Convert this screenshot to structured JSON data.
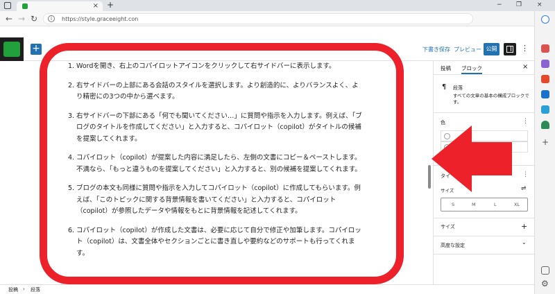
{
  "browser": {
    "url": "https://style.graceeight.con",
    "tab_close": "×",
    "new_tab": "+",
    "window_controls": [
      "−",
      "❐",
      "×"
    ]
  },
  "editor_toolbar": {
    "save_draft": "下書き保存",
    "preview": "プレビュー",
    "publish": "公開",
    "add_block": "+"
  },
  "content": {
    "items": [
      {
        "num": "1.",
        "text": "Wordを開き、右上のコパイロットアイコンをクリックして右サイドバーに表示します。"
      },
      {
        "num": "2.",
        "text": "右サイドバーの上部にある会話のスタイルを選択します。より創造的に、よりバランスよく、より精密にの3つの中から選べます。"
      },
      {
        "num": "3.",
        "text": "右サイドバーの下部にある「何でも聞いてください…」に質問や指示を入力します。例えば、「ブログのタイトルを作成してください」と入力すると、コパイロット（copilot）がタイトルの候補を提案してくれます。"
      },
      {
        "num": "4.",
        "text": "コパイロット（copilot）が提案した内容に満足したら、左側の文書にコピー＆ペーストします。不満なら、「もっと違うものを提案してください」と入力すると、別の候補を提案してくれます。"
      },
      {
        "num": "5.",
        "text": "ブログの本文も同様に質問や指示を入力してコパイロット（copilot）に作成してもらいます。例えば、「このトピックに関する背景情報を書いてください」と入力すると、コパイロット（copilot）が参照したデータや情報をもとに背景情報を記述してくれます。"
      },
      {
        "num": "6.",
        "text": "コパイロット（copilot）が作成した文書は、必要に応じて自分で修正や加筆します。コパイロット（copilot）は、文書全体やセクションごとに書き直しや要約などのサポートも行ってくれます。"
      }
    ]
  },
  "sidebar": {
    "tab_post": "投稿",
    "tab_block": "ブロック",
    "close": "×",
    "block_icon": "¶",
    "block_title": "段落",
    "block_desc": "すべての文章の基本の構成ブロックです。",
    "color_label": "色",
    "typography_label": "タイ",
    "size_label": "サイズ",
    "size_options": [
      "S",
      "M",
      "L",
      "XL"
    ],
    "dimensions_label": "サイズ",
    "advanced_label": "高度な設定",
    "more": "⋮",
    "plus": "+",
    "chevron": "⌄"
  },
  "statusbar": {
    "crumb_post": "投稿",
    "separator": "›",
    "crumb_paragraph": "段落"
  },
  "colors": {
    "accent": "#2271b1",
    "highlight_red": "#ed2129",
    "logo_green": "#21a03c"
  },
  "icons": [
    "windows-icon",
    "favicon-icon",
    "back-icon",
    "forward-icon",
    "reload-icon",
    "info-icon",
    "undo-icon",
    "redo-icon",
    "list-view-icon",
    "settings-panel-icon",
    "more-icon",
    "paragraph-icon",
    "sliders-icon",
    "bing-icon",
    "shopping-icon",
    "tools-icon",
    "office-icon",
    "outlook-icon",
    "send-icon",
    "tree-icon",
    "plus-icon",
    "sidebar-toggle-icon",
    "gear-icon"
  ]
}
